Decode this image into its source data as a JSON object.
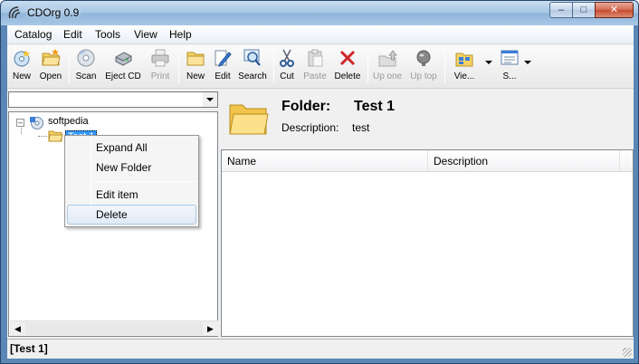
{
  "window": {
    "title": "CDOrg 0.9"
  },
  "menu": [
    "Catalog",
    "Edit",
    "Tools",
    "View",
    "Help"
  ],
  "toolbar": {
    "new": "New",
    "open": "Open",
    "scan": "Scan",
    "eject": "Eject CD",
    "print": "Print",
    "new2": "New",
    "edit": "Edit",
    "search": "Search",
    "cut": "Cut",
    "paste": "Paste",
    "delete": "Delete",
    "up_one": "Up one",
    "up_top": "Up top",
    "view": "Vie...",
    "s": "S..."
  },
  "tree": {
    "root": "softpedia",
    "child": "Test 1"
  },
  "folder": {
    "label": "Folder:",
    "name": "Test 1",
    "description_label": "Description:",
    "description": "test"
  },
  "list": {
    "columns": [
      "Name",
      "Description"
    ]
  },
  "context_menu": {
    "items": [
      "Expand All",
      "New Folder",
      "Edit item",
      "Delete"
    ]
  },
  "status": {
    "text": "[Test 1]"
  },
  "colors": {
    "selection": "#3399ff",
    "title_bar": "#a4c4e4",
    "close_button": "#c44a2e"
  }
}
